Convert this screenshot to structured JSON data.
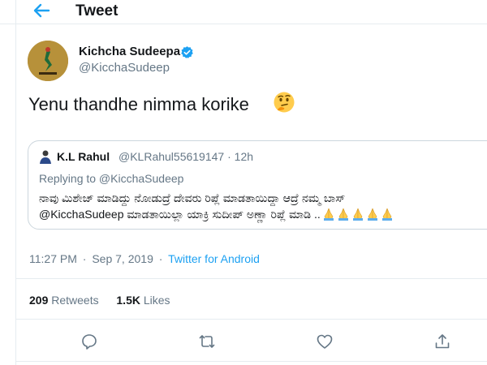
{
  "header": {
    "title": "Tweet",
    "back_icon": "arrow-left-icon"
  },
  "colors": {
    "accent": "#1da1f2",
    "secondary_text": "#657786",
    "border": "#e6ecf0"
  },
  "tweet": {
    "author_name": "Kichcha Sudeepa",
    "author_handle": "@KicchaSudeep",
    "verified": true,
    "text": "Yenu thandhe nimma korike",
    "emoji": "thinking-face",
    "time": "11:27 PM",
    "date": "Sep 7, 2019",
    "source": "Twitter for Android",
    "retweets_count": "209",
    "retweets_label": "Retweets",
    "likes_count": "1.5K",
    "likes_label": "Likes"
  },
  "quoted": {
    "author_name": "K.L Rahul",
    "author_handle": "@KLRahul55619147",
    "age": "12h",
    "replying_to": "Replying to @KicchaSudeep",
    "line1": "ನಾವು ಮಿಶೇಜ್ ಮಾಡಿದ್ದು ನೋಡುದ್ರೆ ದೇವರು ರಿಪ್ಲೆ ಮಾಡತಾಯಿದ್ದಾ ಆದ್ರೆ ನಮ್ಮ ಬಾಸ್",
    "line2": "@KicchaSudeep  ಮಾಡತಾಯಿಲ್ಲಾ ಯಾಕ್ರಿ ಸುದೀಪ್ ಅಣ್ಣಾ ರಿಪ್ಲೆ ಮಾಡಿ ..",
    "emoji_repeat": 5,
    "emoji": "folded-hands"
  },
  "actions": [
    "reply-icon",
    "retweet-icon",
    "like-icon",
    "share-icon"
  ]
}
